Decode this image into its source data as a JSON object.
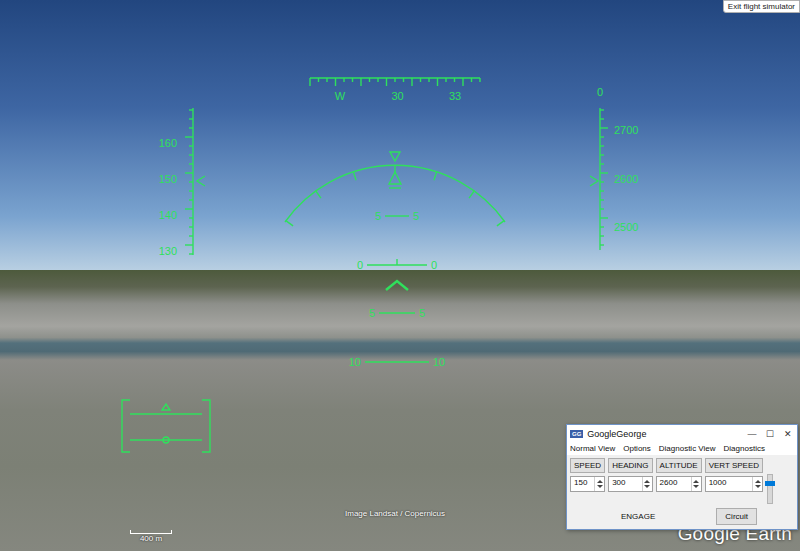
{
  "app": {
    "exit_button": "Exit flight simulator",
    "imagery_credit": "Image Landsat / Copernicus",
    "logo": "Google Earth",
    "scale": "400 m"
  },
  "hud": {
    "heading_tape": [
      "W",
      "30",
      "33"
    ],
    "speed_tape": [
      "160",
      "150",
      "140",
      "130"
    ],
    "altitude_tape": [
      "2700",
      "2600",
      "2500"
    ],
    "vertical_speed": "0",
    "pitch_ladder": [
      {
        "left": "5",
        "right": "5"
      },
      {
        "left": "0",
        "right": "0"
      },
      {
        "left": "5",
        "right": "5"
      },
      {
        "left": "10",
        "right": "10"
      }
    ]
  },
  "dialog": {
    "title": "GoogleGeorge",
    "icon": "GG",
    "controls": [
      "—",
      "☐",
      "✕"
    ],
    "menu": [
      "Normal View",
      "Options",
      "Diagnostic View",
      "Diagnostics"
    ],
    "modes": [
      {
        "label": "SPEED",
        "value": "150"
      },
      {
        "label": "HEADING",
        "value": "300"
      },
      {
        "label": "ALTITUDE",
        "value": "2600"
      },
      {
        "label": "VERT SPEED",
        "value": "1000"
      }
    ],
    "engage": "ENGAGE",
    "circuit": "Circuit"
  }
}
